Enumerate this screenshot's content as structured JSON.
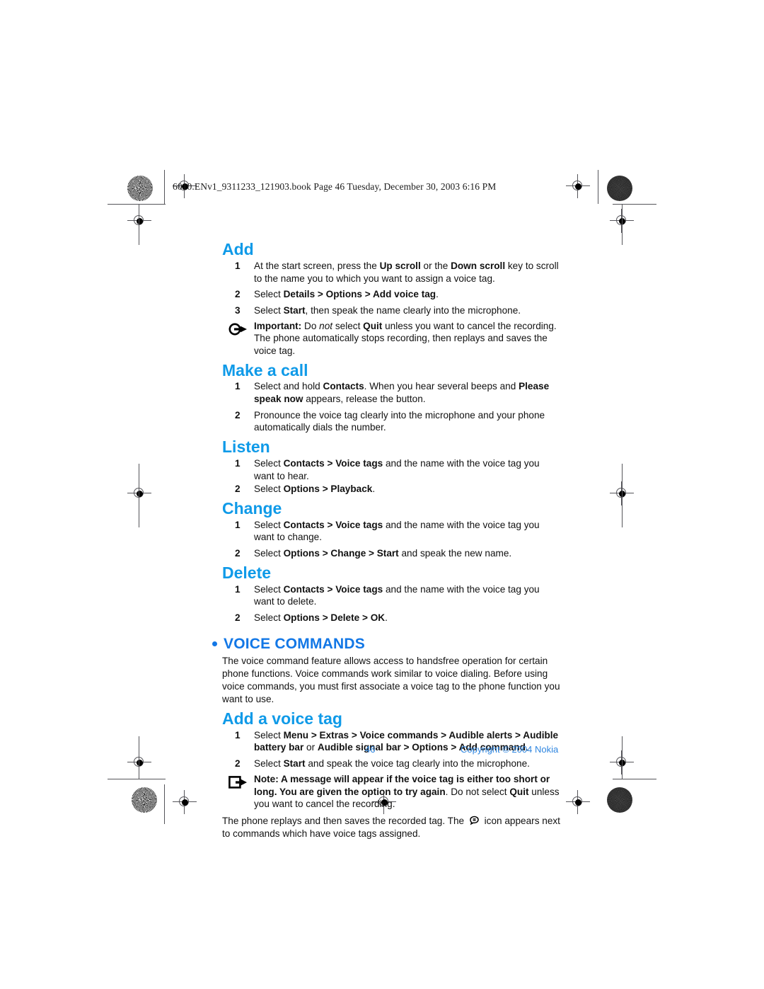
{
  "page": {
    "header_slug": "6010.ENv1_9311233_121903.book  Page 46  Tuesday, December 30, 2003  6:16 PM",
    "footer_page_number": "46",
    "footer_copyright": "Copyright © 2004 Nokia",
    "accent_blue": "#0f9ae8",
    "chapter_blue": "#1277e6",
    "footer_blue": "#2f86e0"
  },
  "sections": {
    "add": {
      "heading": "Add",
      "step1": {
        "num": "1",
        "html": "At the start screen, press the <b>Up scroll</b> or the <b>Down scroll</b> key to scroll to the name you to which you want to assign a voice tag."
      },
      "step2": {
        "num": "2",
        "html": "Select <b>Details &gt; Options &gt; Add voice tag</b>."
      },
      "step3": {
        "num": "3",
        "html": "Select <b>Start</b>, then speak the name clearly into the microphone."
      },
      "important": {
        "icon": "circle-arrow-icon",
        "html": "<b>Important:</b> Do <i>not</i> select <b>Quit</b> unless you want to cancel the recording. The phone automatically stops recording, then replays and saves the voice tag."
      }
    },
    "make_a_call": {
      "heading": "Make a call",
      "step1": {
        "num": "1",
        "html": "Select and hold <b>Contacts</b>. When you hear several beeps and <b>Please speak now</b> appears, release the button."
      },
      "step2": {
        "num": "2",
        "html": "Pronounce the voice tag clearly into the microphone and your phone automatically dials the number."
      }
    },
    "listen": {
      "heading": "Listen",
      "step1": {
        "num": "1",
        "html": "Select <b>Contacts &gt; Voice tags</b> and the name with the voice tag you want to hear."
      },
      "step2": {
        "num": "2",
        "html": "Select <b>Options &gt; Playback</b>."
      }
    },
    "change": {
      "heading": "Change",
      "step1": {
        "num": "1",
        "html": "Select <b>Contacts &gt; Voice tags</b> and the name with the voice tag you want to change."
      },
      "step2": {
        "num": "2",
        "html": "Select <b>Options &gt; Change &gt; Start</b> and speak the new name."
      }
    },
    "delete": {
      "heading": "Delete",
      "step1": {
        "num": "1",
        "html": "Select <b>Contacts &gt; Voice tags</b> and the name with the voice tag you want to delete."
      },
      "step2": {
        "num": "2",
        "html": "Select <b>Options &gt; Delete &gt; OK</b>."
      }
    },
    "voice_commands": {
      "heading": "VOICE COMMANDS",
      "intro": "The voice command feature allows access to handsfree operation for certain phone functions. Voice commands work similar to voice dialing. Before using voice commands, you must first associate a voice tag to the phone function you want to use."
    },
    "add_a_voice_tag": {
      "heading": "Add a voice tag",
      "step1": {
        "num": "1",
        "html": "Select <b>Menu &gt; Extras &gt; Voice commands &gt; Audible alerts &gt; Audible battery bar</b> or <b>Audible signal bar &gt; Options &gt; Add command</b>."
      },
      "step2": {
        "num": "2",
        "html": "Select <b>Start</b> and speak the voice tag clearly into the microphone."
      },
      "note": {
        "icon": "square-arrow-icon",
        "html": "<b>Note: A message will appear if the voice tag is either too short or long. You are given the option to try again</b>. Do not select <b>Quit</b> unless you want to cancel the recording."
      },
      "closing_html": "The phone replays and then saves the recorded tag. The <span class=\"inline-icon-slot\"></span> icon appears next to commands which have voice tags assigned."
    }
  }
}
